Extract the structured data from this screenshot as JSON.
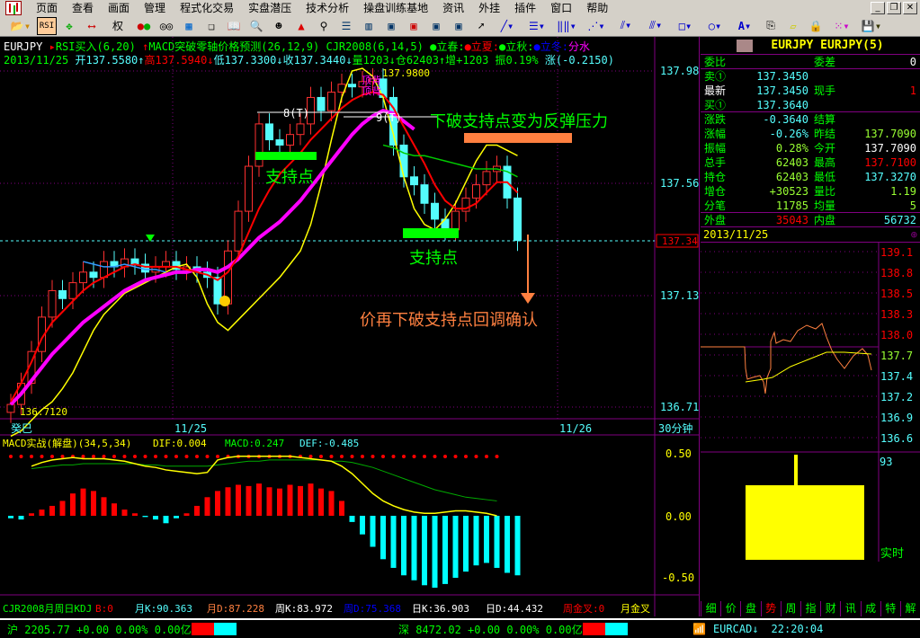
{
  "menu": [
    "页面",
    "查看",
    "画面",
    "管理",
    "程式化交易",
    "实盘潜压",
    "技术分析",
    "操盘训练基地",
    "资讯",
    "外挂",
    "插件",
    "窗口",
    "帮助"
  ],
  "toolbar": {
    "rsi_label": "RSI",
    "quan_label": "权",
    "font_label": "A"
  },
  "header": {
    "symbol": "EURJPY",
    "ind1": "RSI买入(6,20)",
    "ind2": "MACD突破零轴价格预测(26,12,9)",
    "ind3": "CJR2008(6,14,5)",
    "season1": "立春:",
    "season2": "立夏:",
    "season3": "立秋:",
    "season4": "立冬:",
    "season5": "分水",
    "date": "2013/11/25",
    "open": "开137.5580",
    "high": "高137.5940",
    "low": "低137.3300",
    "close": "收137.3440",
    "vol": "量1203",
    "oi": "仓62403",
    "inc": "增+1203",
    "amp": "振0.19%",
    "chg": "涨(-0.2150)"
  },
  "price_axis": [
    "137.98",
    "137.56",
    "137.13",
    "136.71"
  ],
  "current_price_tag": "137.34",
  "annotations": {
    "high_label": "137.9800",
    "low_label": "136.7120",
    "top_div1": "顶背",
    "top_div2": "顶背",
    "count1": "8(T)",
    "count2": "9(T)",
    "support1": "支持点",
    "support2": "支持点",
    "resistance": "下破支持点变为反弹压力",
    "confirm": "价再下破支持点回调确认"
  },
  "time_axis": {
    "start": "癸巳",
    "d1": "11/25",
    "d2": "11/26",
    "period": "30分钟"
  },
  "macd": {
    "title": "MACD实战(解盘)(34,5,34)",
    "dif": "DIF:0.004",
    "macd": "MACD:0.247",
    "def": "DEF:-0.485",
    "axis": [
      "0.50",
      "0.00",
      "-0.50"
    ]
  },
  "kdj": {
    "name": "CJR2008月周日KDJ",
    "b": "B:0",
    "mk": "月K:90.363",
    "md": "月D:87.228",
    "wk": "周K:83.972",
    "wd": "周D:75.368",
    "dk": "日K:36.903",
    "dd": "日D:44.432",
    "wx": "周金叉:0",
    "mx": "月金叉"
  },
  "chart_data": {
    "type": "candlestick",
    "closes": [
      136.72,
      136.8,
      136.92,
      137.05,
      137.15,
      137.12,
      137.18,
      137.22,
      137.2,
      137.26,
      137.24,
      137.27,
      137.25,
      137.22,
      137.24,
      137.26,
      137.23,
      137.24,
      137.22,
      137.2,
      137.1,
      137.3,
      137.45,
      137.62,
      137.78,
      137.72,
      137.7,
      137.74,
      137.78,
      137.88,
      137.83,
      137.9,
      137.93,
      137.92,
      137.94,
      137.95,
      137.88,
      137.7,
      137.58,
      137.55,
      137.48,
      137.42,
      137.38,
      137.45,
      137.5,
      137.55,
      137.6,
      137.62,
      137.5,
      137.34
    ],
    "ma_red": [
      136.73,
      136.8,
      136.88,
      136.97,
      137.03,
      137.07,
      137.11,
      137.15,
      137.18,
      137.2,
      137.22,
      137.24,
      137.25,
      137.24,
      137.24,
      137.24,
      137.24,
      137.23,
      137.22,
      137.21,
      137.19,
      137.22,
      137.28,
      137.37,
      137.46,
      137.53,
      137.59,
      137.63,
      137.67,
      137.72,
      137.76,
      137.8,
      137.84,
      137.87,
      137.89,
      137.9,
      137.89,
      137.84,
      137.77,
      137.7,
      137.63,
      137.55,
      137.49,
      137.46,
      137.46,
      137.48,
      137.52,
      137.56,
      137.56,
      137.52
    ],
    "ma_magenta": [
      136.72,
      136.76,
      136.81,
      136.86,
      136.91,
      136.95,
      136.99,
      137.03,
      137.06,
      137.09,
      137.12,
      137.15,
      137.17,
      137.19,
      137.2,
      137.21,
      137.22,
      137.22,
      137.23,
      137.23,
      137.22,
      137.24,
      137.27,
      137.31,
      137.35,
      137.38,
      137.41,
      137.45,
      137.49,
      137.54,
      137.59,
      137.64,
      137.69,
      137.74,
      137.78,
      137.81,
      137.83,
      137.82,
      137.79,
      137.76
    ],
    "band_yellow": [
      136.6,
      136.62,
      136.66,
      136.7,
      136.73,
      136.78,
      136.84,
      136.92,
      137.0,
      137.06,
      137.1,
      137.14,
      137.16,
      137.18,
      137.2,
      137.22,
      137.24,
      137.25,
      137.2,
      137.1,
      137.03,
      137.0,
      137.04,
      137.08,
      137.12,
      137.16,
      137.2,
      137.25,
      137.3,
      137.4,
      137.55,
      137.72,
      137.88,
      137.98,
      137.99,
      137.96,
      137.88,
      137.74,
      137.58,
      137.46,
      137.4,
      137.38,
      137.42,
      137.48,
      137.56,
      137.64,
      137.7,
      137.7,
      137.68,
      137.66
    ],
    "green_line": [
      137.7,
      137.69,
      137.67,
      137.66,
      137.66,
      137.65,
      137.64,
      137.63,
      137.62,
      137.61,
      137.61,
      137.61,
      137.6,
      137.58
    ],
    "blue_line": [
      137.26,
      137.25,
      137.24,
      137.24,
      137.25,
      137.24,
      137.23,
      137.23,
      137.22
    ],
    "macd_hist": [
      -0.02,
      -0.03,
      0.02,
      0.05,
      0.08,
      0.12,
      0.18,
      0.22,
      0.2,
      0.15,
      0.1,
      0.05,
      0.02,
      -0.01,
      -0.03,
      -0.06,
      -0.02,
      0.02,
      0.08,
      0.15,
      0.2,
      0.23,
      0.25,
      0.24,
      0.26,
      0.23,
      0.22,
      0.25,
      0.24,
      0.26,
      0.22,
      0.2,
      0.12,
      -0.05,
      -0.15,
      -0.25,
      -0.35,
      -0.42,
      -0.48,
      -0.52,
      -0.56,
      -0.58,
      -0.55,
      -0.5,
      -0.45,
      -0.4,
      -0.38,
      -0.42,
      -0.46,
      -0.48
    ],
    "dif": [
      0.4,
      0.43,
      0.45,
      0.46,
      0.47,
      0.46,
      0.46,
      0.46,
      0.45,
      0.44,
      0.42,
      0.4,
      0.39,
      0.37,
      0.36,
      0.35,
      0.34,
      0.35,
      0.45,
      0.47,
      0.48,
      0.48,
      0.48,
      0.48,
      0.48,
      0.48,
      0.47,
      0.46,
      0.45,
      0.44,
      0.4,
      0.34,
      0.26,
      0.18,
      0.12,
      0.08,
      0.05,
      0.03,
      0.02,
      0.02,
      0.03,
      0.04,
      0.04,
      0.03,
      0.02,
      0.0
    ],
    "dea": [
      0.38,
      0.39,
      0.4,
      0.41,
      0.41,
      0.42,
      0.42,
      0.42,
      0.42,
      0.42,
      0.42,
      0.41,
      0.41,
      0.4,
      0.4,
      0.4,
      0.4,
      0.4,
      0.41,
      0.42,
      0.43,
      0.44,
      0.44,
      0.45,
      0.45,
      0.45,
      0.45,
      0.45,
      0.45,
      0.44,
      0.44,
      0.43,
      0.41,
      0.39,
      0.36,
      0.33,
      0.3,
      0.27,
      0.24,
      0.21,
      0.19,
      0.17,
      0.15,
      0.14,
      0.13,
      0.12
    ]
  },
  "quote": {
    "title": "EURJPY EURJPY(5)",
    "rows": [
      {
        "l": "委比",
        "v": "",
        "l2": "委差",
        "v2": "0"
      },
      {
        "l": "卖①",
        "v": "137.3450",
        "l2": "",
        "v2": ""
      },
      {
        "l": "最新",
        "v": "137.3450",
        "l2": "现手",
        "v2": "1"
      },
      {
        "l": "买①",
        "v": "137.3640",
        "l2": "",
        "v2": ""
      },
      {
        "l": "涨跌",
        "v": "-0.3640",
        "l2": "结算",
        "v2": ""
      },
      {
        "l": "涨幅",
        "v": "-0.26%",
        "l2": "昨结",
        "v2": "137.7090"
      },
      {
        "l": "振幅",
        "v": "0.28%",
        "l2": "今开",
        "v2": "137.7090"
      },
      {
        "l": "总手",
        "v": "62403",
        "l2": "最高",
        "v2": "137.7100"
      },
      {
        "l": "持仓",
        "v": "62403",
        "l2": "最低",
        "v2": "137.3270"
      },
      {
        "l": "增仓",
        "v": "+30523",
        "l2": "量比",
        "v2": "1.19"
      },
      {
        "l": "分笔",
        "v": "11785",
        "l2": "均量",
        "v2": "5"
      },
      {
        "l": "外盘",
        "v": "35043",
        "l2": "内盘",
        "v2": "56732"
      }
    ],
    "date": "2013/11/25",
    "axis": [
      "139.1",
      "138.8",
      "138.5",
      "138.3",
      "138.0",
      "137.7",
      "137.4",
      "137.2",
      "136.9",
      "136.6"
    ],
    "vol_max": "93",
    "realtime": "实时"
  },
  "tabs": [
    "细",
    "价",
    "盘",
    "势",
    "周",
    "指",
    "财",
    "讯",
    "成",
    "特",
    "解"
  ],
  "status": {
    "sh": "沪 2205.77 +0.00 0.00% 0.00亿",
    "sz": "深 8472.02 +0.00 0.00% 0.00亿",
    "symbol": "EURCAD",
    "time": "22:20:04"
  },
  "colors": {
    "up": "#ff3030",
    "down": "#54fcfc",
    "purple": "#800080",
    "yellow": "#ffff00",
    "green": "#00ff00"
  }
}
